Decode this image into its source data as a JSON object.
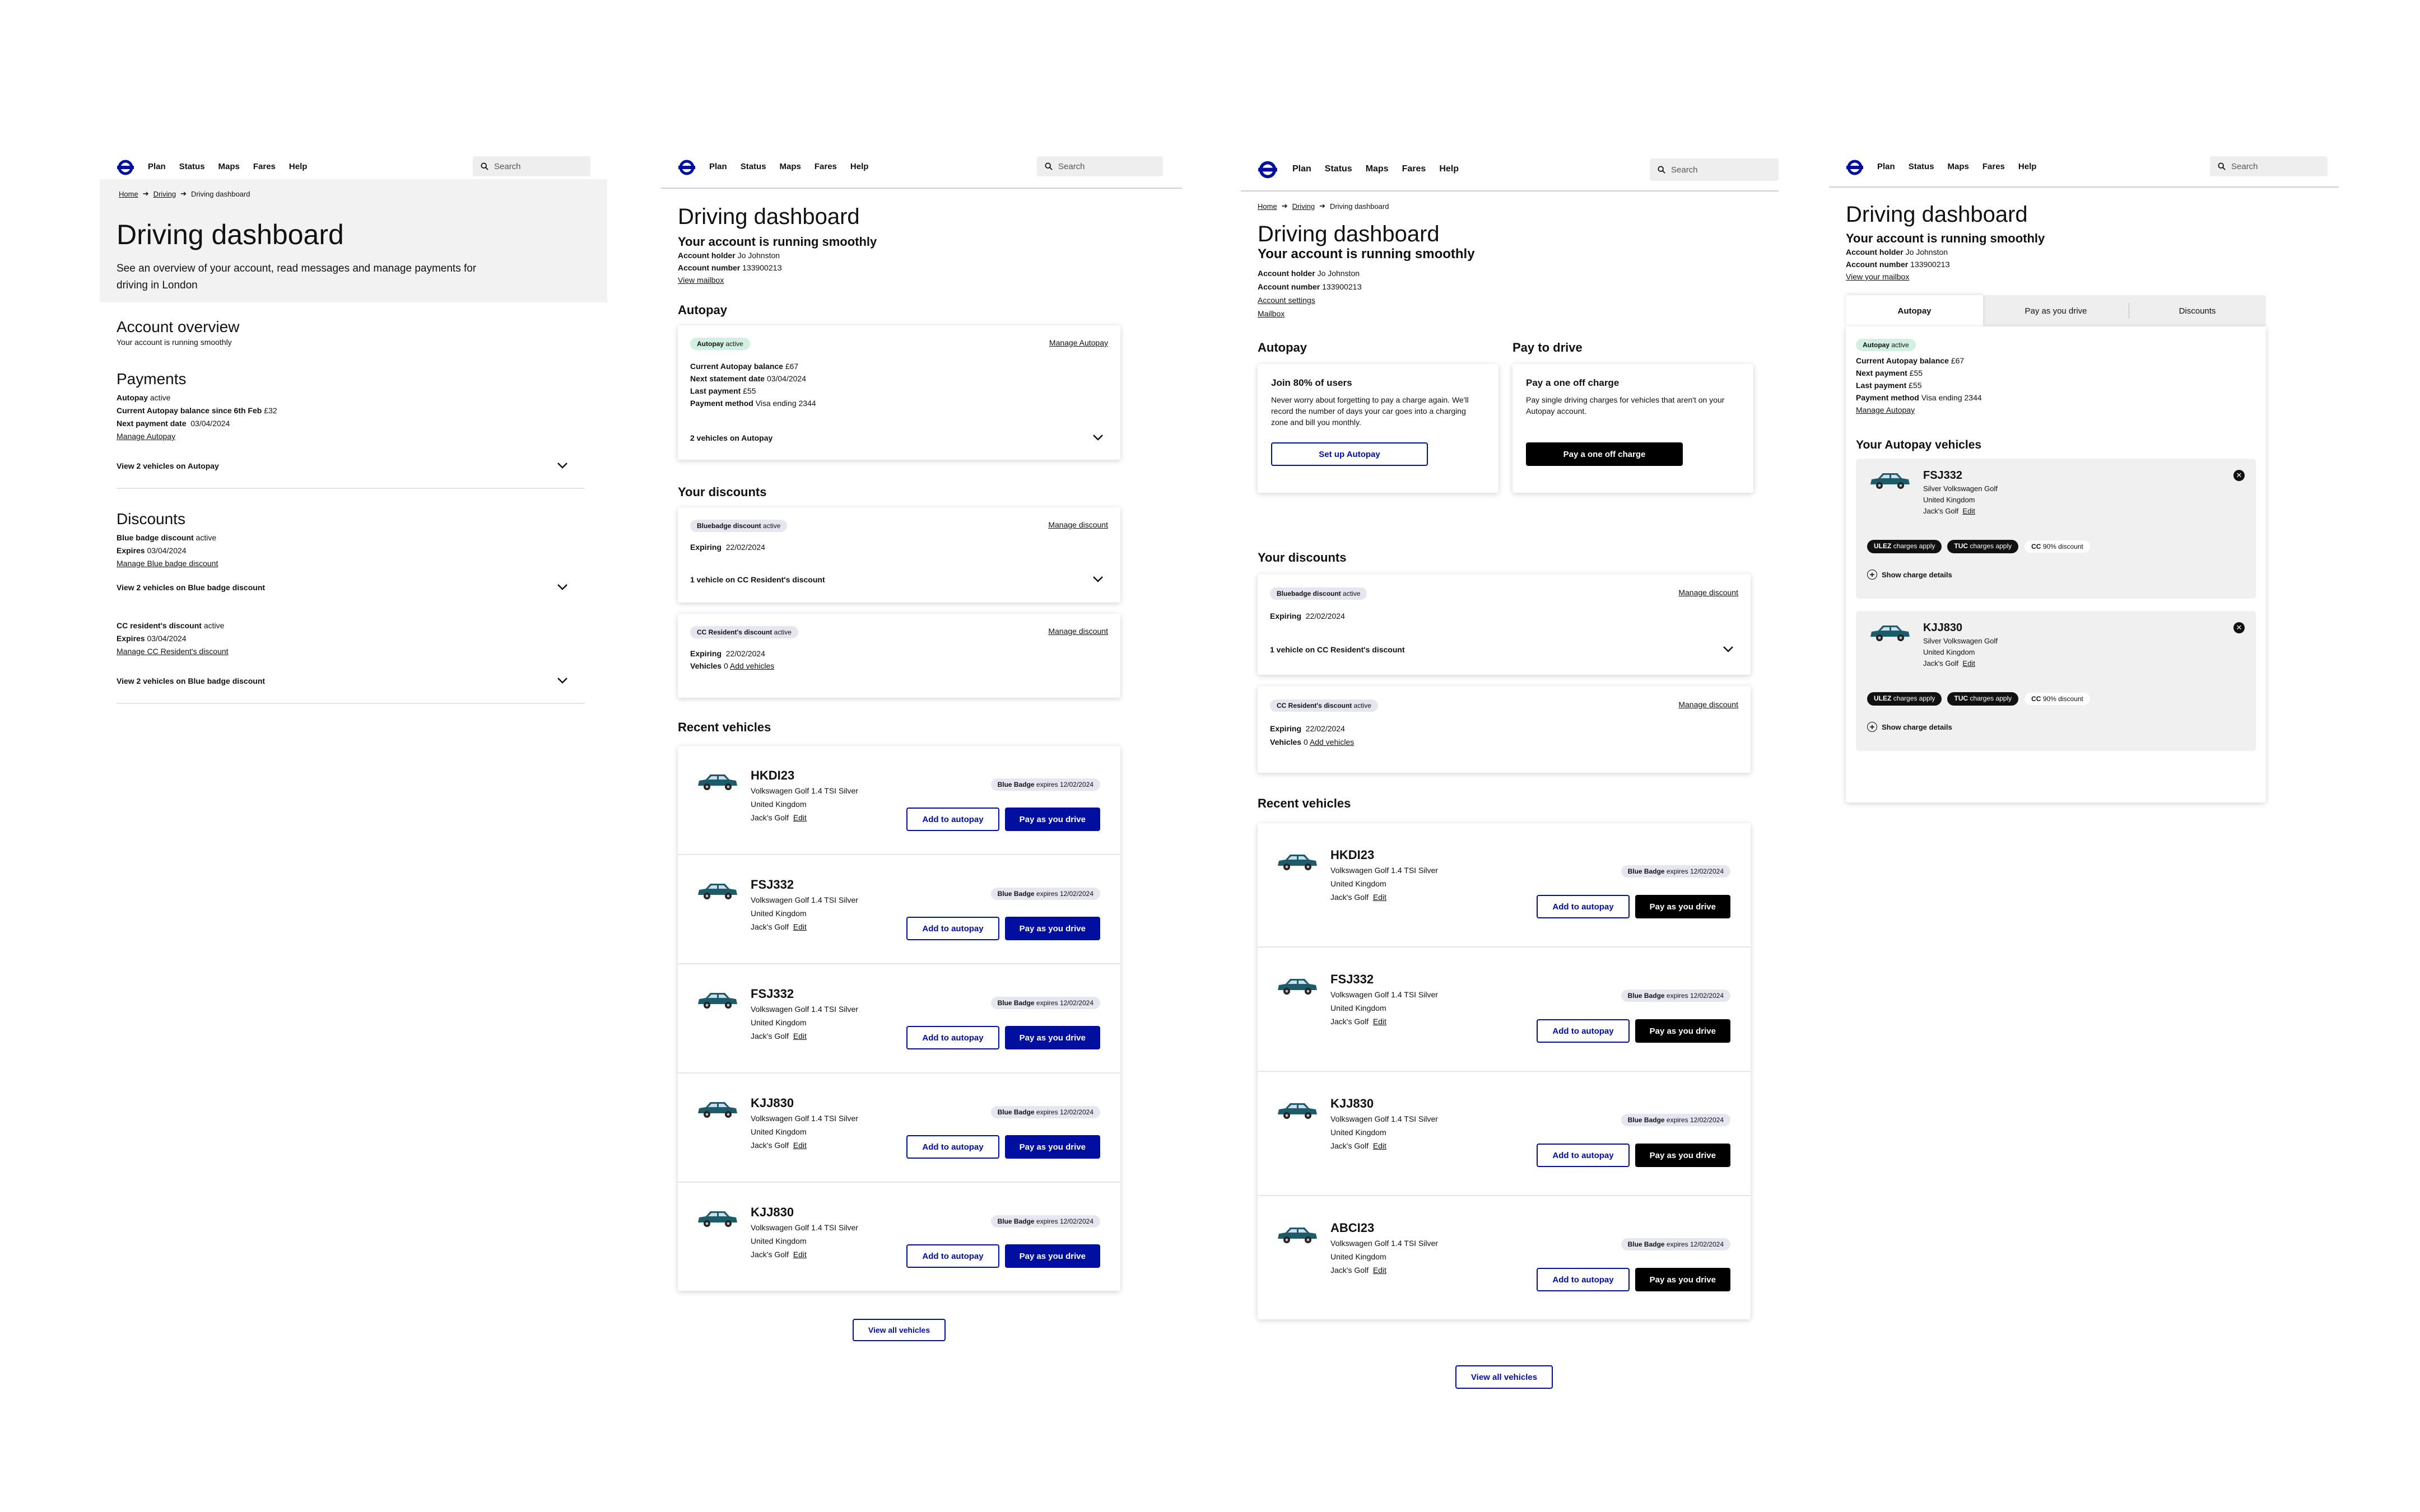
{
  "nav": {
    "links": [
      "Plan",
      "Status",
      "Maps",
      "Fares",
      "Help"
    ],
    "search_placeholder": "Search"
  },
  "colors": {
    "brand_blue": "#000f9f",
    "logo_red": "#dc241f",
    "car_teal": "#1c5c6a",
    "autopay_green": "#d2f0e1"
  },
  "common": {
    "title": "Driving dashboard",
    "running": "Your account is running smoothly",
    "account_holder_label": "Account holder",
    "account_holder": "Jo Johnston",
    "account_number_label": "Account number",
    "account_number": "13390021З",
    "view_mailbox": "View mailbox",
    "autopay": "Autopay",
    "your_discounts": "Your discounts",
    "recent_vehicles": "Recent vehicles",
    "view_all_vehicles": "View all vehicles",
    "add_to_autopay": "Add to autopay",
    "pay_as_you_drive": "Pay as you drive",
    "edit": "Edit",
    "blue_badge": "Blue Badge",
    "badge_expires": "expires 12/02/2024",
    "vehicle_desc": "Volkswagen Golf 1.4 TSI Silver",
    "country": "United Kingdom",
    "nickname": "Jack's Golf",
    "manage_discount": "Manage discount",
    "expiring_label": "Expiring",
    "expiring": "22/02/2024",
    "bluebadge_discount": "Bluebadge discount",
    "active": "active",
    "cc_resident_discount": "CC Resident's discount",
    "one_vehicle_cc": "1 vehicle on CC Resident's discount",
    "vehicles_label": "Vehicles",
    "vehicles_zero": "0",
    "add_vehicles": "Add vehicles"
  },
  "panel1": {
    "breadcrumb": [
      "Home",
      "Driving",
      "Driving dashboard"
    ],
    "title": "Driving dashboard",
    "intro": "See an overview of your account, read messages and manage payments for driving in London",
    "overview_title": "Account overview",
    "overview_sub": "Your account is running smoothly",
    "payments_title": "Payments",
    "autopay_label": "Autopay",
    "autopay_status": "active",
    "balance_label": "Current Autopay balance since 6th Feb",
    "balance": "£32",
    "next_payment_label": "Next payment date",
    "next_payment": "03/04/2024",
    "manage_autopay": "Manage Autopay",
    "view_autopay": "View 2 vehicles on Autopay",
    "discounts_title": "Discounts",
    "bb_label": "Blue badge discount",
    "bb_status": "active",
    "expires_label": "Expires",
    "bb_expires": "03/04/2024",
    "manage_bb": "Manage Blue badge discount",
    "view_bb": "View 2 vehicles on Blue badge discount",
    "cc_label": "CC resident's discount",
    "cc_status": "active",
    "cc_expires": "03/04/2024",
    "manage_cc": "Manage CC Resident's discount",
    "view_bb2": "View 2 vehicles on Blue badge discount"
  },
  "panel2": {
    "autopay_pill": "Autopay",
    "autopay_pill_status": "active",
    "manage_autopay": "Manage Autopay",
    "balance_label": "Current Autopay balance",
    "balance": "£67",
    "statement_label": "Next statement date",
    "statement": "03/04/2024",
    "last_payment_label": "Last payment",
    "last_payment": "£55",
    "method_label": "Payment method",
    "method": "Visa ending 2344",
    "vehicles_on_autopay": "2 vehicles on Autopay",
    "vehicles": [
      {
        "reg": "HKDI23"
      },
      {
        "reg": "FSJ332"
      },
      {
        "reg": "FSJ332"
      },
      {
        "reg": "KJJ830"
      },
      {
        "reg": "KJJ830"
      }
    ]
  },
  "panel3": {
    "breadcrumb": [
      "Home",
      "Driving",
      "Driving dashboard"
    ],
    "account_settings": "Account settings",
    "mailbox": "Mailbox",
    "pay_to_drive": "Pay to drive",
    "join_title": "Join 80% of users",
    "join_text": "Never worry about forgetting to pay a charge again. We'll record the number of days your car goes into a charging zone and bill you monthly.",
    "setup_autopay": "Set up Autopay",
    "oneoff_title": "Pay a one off charge",
    "oneoff_text": "Pay single driving charges for vehicles that aren't on your Autopay account.",
    "oneoff_button": "Pay a one off charge",
    "vehicles": [
      {
        "reg": "HKDI23"
      },
      {
        "reg": "FSJ332"
      },
      {
        "reg": "KJJ830"
      },
      {
        "reg": "ABCI23"
      }
    ]
  },
  "panel4": {
    "view_mailbox": "View your mailbox",
    "tabs": [
      "Autopay",
      "Pay as you drive",
      "Discounts"
    ],
    "balance_label": "Current Autopay balance",
    "balance": "£67",
    "next_payment_label": "Next payment",
    "next_payment": "£55",
    "last_payment_label": "Last payment",
    "last_payment": "£55",
    "method_label": "Payment method",
    "method": "Visa ending 2344",
    "manage_autopay": "Manage Autopay",
    "your_vehicles": "Your Autopay vehicles",
    "vehicle_desc": "Silver Volkswagen Golf",
    "ulez": "ULEZ",
    "tuc": "TUC",
    "charges_apply": "charges apply",
    "cc": "CC",
    "cc_discount": "90% discount",
    "show_details": "Show charge details",
    "vehicles": [
      {
        "reg": "FSJ332"
      },
      {
        "reg": "KJJ830"
      }
    ]
  }
}
